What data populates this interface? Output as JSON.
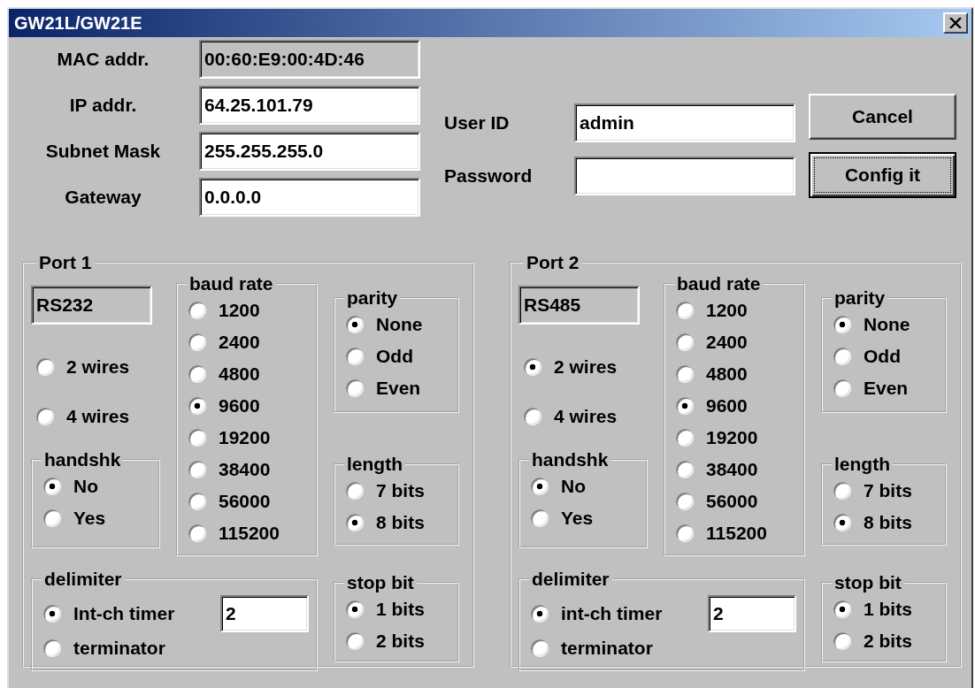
{
  "window": {
    "title": "GW21L/GW21E"
  },
  "network_fields": [
    {
      "label": "MAC addr.",
      "value": "00:60:E9:00:4D:46",
      "disabled": true
    },
    {
      "label": "IP addr.",
      "value": "64.25.101.79",
      "disabled": false
    },
    {
      "label": "Subnet Mask",
      "value": "255.255.255.0",
      "disabled": false
    },
    {
      "label": "Gateway",
      "value": "0.0.0.0",
      "disabled": false
    }
  ],
  "login_fields": [
    {
      "label": "User ID",
      "value": "admin"
    },
    {
      "label": "Password"
    }
  ],
  "buttons": [
    {
      "label": "Cancel",
      "focused": false
    },
    {
      "label": "Config it",
      "focused": true
    }
  ],
  "ports": [
    {
      "title": "Port 1",
      "interface": "RS232",
      "wires": [
        {
          "label": "2 wires",
          "selected": false
        },
        {
          "label": "4 wires",
          "selected": false
        }
      ],
      "handshake": {
        "title": "handshk",
        "options": [
          {
            "label": "No",
            "selected": true
          },
          {
            "label": "Yes",
            "selected": false
          }
        ]
      },
      "baud_rate": {
        "title": "baud rate",
        "options": [
          {
            "label": "1200",
            "selected": false
          },
          {
            "label": "2400",
            "selected": false
          },
          {
            "label": "4800",
            "selected": false
          },
          {
            "label": "9600",
            "selected": true
          },
          {
            "label": "19200",
            "selected": false
          },
          {
            "label": "38400",
            "selected": false
          },
          {
            "label": "56000",
            "selected": false
          },
          {
            "label": "115200",
            "selected": false
          }
        ]
      },
      "parity": {
        "title": "parity",
        "options": [
          {
            "label": "None",
            "selected": true
          },
          {
            "label": "Odd",
            "selected": false
          },
          {
            "label": "Even",
            "selected": false
          }
        ]
      },
      "length": {
        "title": "length",
        "options": [
          {
            "label": "7 bits",
            "selected": false
          },
          {
            "label": "8 bits",
            "selected": true
          }
        ]
      },
      "delimiter": {
        "title": "delimiter",
        "options": [
          {
            "label": "Int-ch timer",
            "selected": true
          },
          {
            "label": "terminator",
            "selected": false
          }
        ],
        "timer_value": "2"
      },
      "stop_bit": {
        "title": "stop bit",
        "options": [
          {
            "label": "1 bits",
            "selected": true
          },
          {
            "label": "2 bits",
            "selected": false
          }
        ]
      }
    },
    {
      "title": "Port 2",
      "interface": "RS485",
      "wires": [
        {
          "label": "2 wires",
          "selected": true
        },
        {
          "label": "4 wires",
          "selected": false
        }
      ],
      "handshake": {
        "title": "handshk",
        "options": [
          {
            "label": "No",
            "selected": true
          },
          {
            "label": "Yes",
            "selected": false
          }
        ]
      },
      "baud_rate": {
        "title": "baud rate",
        "options": [
          {
            "label": "1200",
            "selected": false
          },
          {
            "label": "2400",
            "selected": false
          },
          {
            "label": "4800",
            "selected": false
          },
          {
            "label": "9600",
            "selected": true
          },
          {
            "label": "19200",
            "selected": false
          },
          {
            "label": "38400",
            "selected": false
          },
          {
            "label": "56000",
            "selected": false
          },
          {
            "label": "115200",
            "selected": false
          }
        ]
      },
      "parity": {
        "title": "parity",
        "options": [
          {
            "label": "None",
            "selected": true
          },
          {
            "label": "Odd",
            "selected": false
          },
          {
            "label": "Even",
            "selected": false
          }
        ]
      },
      "length": {
        "title": "length",
        "options": [
          {
            "label": "7 bits",
            "selected": false
          },
          {
            "label": "8 bits",
            "selected": true
          }
        ]
      },
      "delimiter": {
        "title": "delimiter",
        "options": [
          {
            "label": "int-ch timer",
            "selected": true
          },
          {
            "label": "terminator",
            "selected": false
          }
        ],
        "timer_value": "2"
      },
      "stop_bit": {
        "title": "stop bit",
        "options": [
          {
            "label": "1 bits",
            "selected": true
          },
          {
            "label": "2 bits",
            "selected": false
          }
        ]
      }
    }
  ]
}
